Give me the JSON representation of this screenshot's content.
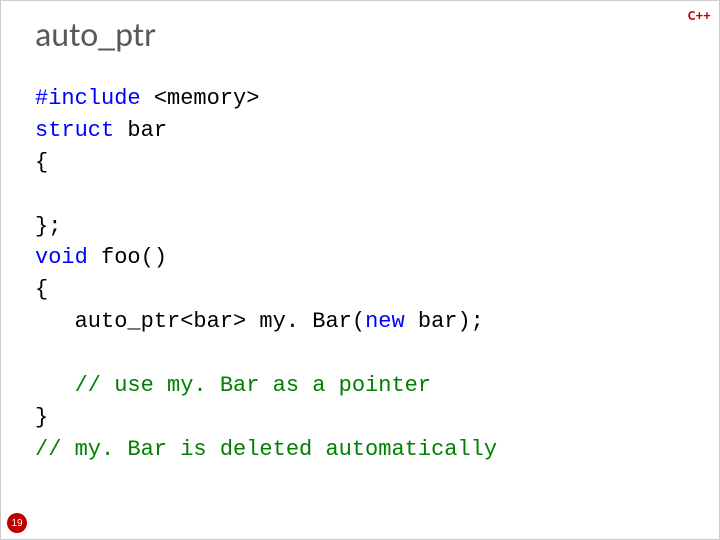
{
  "title": "auto_ptr",
  "badge": "C++",
  "page_number": "19",
  "code": {
    "l1_kw": "#include",
    "l1_rest": " <memory>",
    "l2_kw": "struct",
    "l2_rest": " bar",
    "l3": "{",
    "l4": "};",
    "l5_kw": "void",
    "l5_rest": " foo()",
    "l6": "{",
    "l7_a": "   auto_ptr<bar> my. Bar(",
    "l7_kw": "new",
    "l7_b": " bar);",
    "l8_indent": "   ",
    "l8_comment": "// use my. Bar as a pointer",
    "l9": "}",
    "l10_comment": "// my. Bar is deleted automatically"
  }
}
